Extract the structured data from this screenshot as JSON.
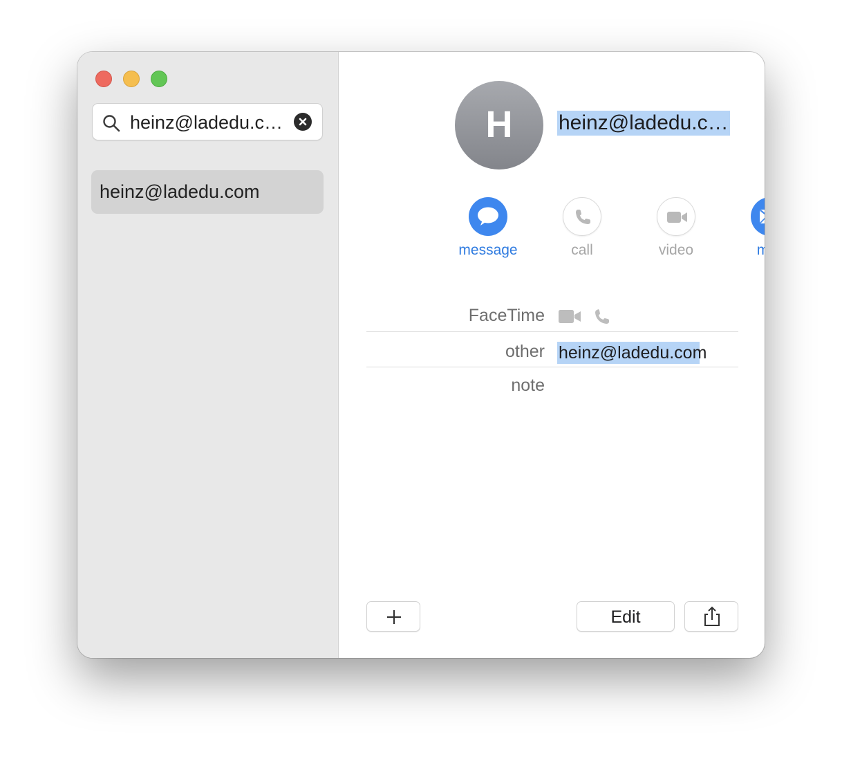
{
  "window": {
    "traffic_lights": [
      "close",
      "minimize",
      "zoom"
    ]
  },
  "sidebar": {
    "search": {
      "value": "heinz@ladedu.c…",
      "icon": "magnifying-glass-icon",
      "clear_icon": "clear-x-icon"
    },
    "contacts": [
      {
        "label": "heinz@ladedu.com",
        "selected": true
      }
    ]
  },
  "detail": {
    "avatar_initial": "H",
    "name": "heinz@ladedu.c…",
    "actions": [
      {
        "label": "message",
        "icon": "message-bubble-icon",
        "enabled": true
      },
      {
        "label": "call",
        "icon": "phone-icon",
        "enabled": false
      },
      {
        "label": "video",
        "icon": "video-camera-icon",
        "enabled": false
      },
      {
        "label": "mail",
        "icon": "envelope-icon",
        "enabled": true
      }
    ],
    "fields": {
      "facetime_label": "FaceTime",
      "other_label": "other",
      "other_value": "heinz@ladedu.com",
      "note_label": "note"
    },
    "buttons": {
      "add": "+",
      "edit": "Edit",
      "share_icon": "share-icon"
    }
  },
  "colors": {
    "accent": "#3e87ee",
    "selection": "#b6d4f6",
    "sidebar_bg": "#e8e8e8",
    "selected_row": "#d3d3d3"
  }
}
